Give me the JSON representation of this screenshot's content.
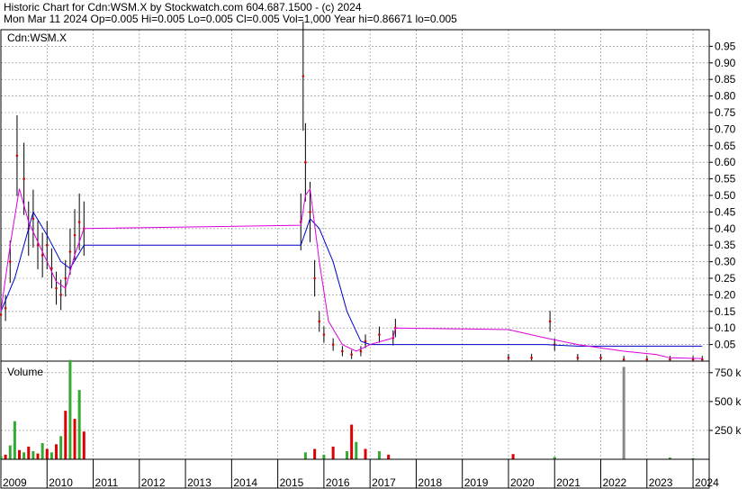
{
  "header": {
    "line1": "Historic Chart for Cdn:WSM.X by Stockwatch.com 604.687.1500 - (c) 2024",
    "line2": "Mon Mar 11 2024   Op=0.005  Hi=0.005  Lo=0.005  Cl=0.005  Vol=1,000  Year hi=0.86671  lo=0.005"
  },
  "chart_data": [
    {
      "type": "line",
      "title": "Cdn:WSM.X",
      "x_labels": [
        "2009",
        "2010",
        "2011",
        "2012",
        "2013",
        "2014",
        "2015",
        "2016",
        "2017",
        "2018",
        "2019",
        "2020",
        "2021",
        "2022",
        "2023",
        "2024"
      ],
      "y_ticks": [
        0.05,
        0.1,
        0.15,
        0.2,
        0.25,
        0.3,
        0.35,
        0.4,
        0.45,
        0.5,
        0.55,
        0.6,
        0.65,
        0.7,
        0.75,
        0.8,
        0.85,
        0.9,
        0.95
      ],
      "ylim": [
        0,
        1.0
      ],
      "grid": true,
      "colors": {
        "price": "#000000",
        "close_dot": "#cc0000",
        "ma_short": "#dd00dd",
        "ma_long": "#0000cc"
      },
      "price_points": [
        [
          2009.0,
          0.14
        ],
        [
          2009.1,
          0.16
        ],
        [
          2009.2,
          0.3
        ],
        [
          2009.35,
          0.62
        ],
        [
          2009.5,
          0.55
        ],
        [
          2009.6,
          0.4
        ],
        [
          2009.7,
          0.43
        ],
        [
          2009.8,
          0.35
        ],
        [
          2009.9,
          0.32
        ],
        [
          2010.0,
          0.35
        ],
        [
          2010.1,
          0.28
        ],
        [
          2010.2,
          0.22
        ],
        [
          2010.3,
          0.2
        ],
        [
          2010.4,
          0.25
        ],
        [
          2010.5,
          0.33
        ],
        [
          2010.6,
          0.38
        ],
        [
          2010.7,
          0.42
        ],
        [
          2010.8,
          0.4
        ],
        [
          2015.5,
          0.42
        ],
        [
          2015.55,
          0.86
        ],
        [
          2015.6,
          0.6
        ],
        [
          2015.7,
          0.45
        ],
        [
          2015.8,
          0.25
        ],
        [
          2015.9,
          0.12
        ],
        [
          2016.0,
          0.08
        ],
        [
          2016.2,
          0.05
        ],
        [
          2016.4,
          0.03
        ],
        [
          2016.6,
          0.02
        ],
        [
          2016.8,
          0.03
        ],
        [
          2016.9,
          0.06
        ],
        [
          2017.2,
          0.08
        ],
        [
          2017.5,
          0.07
        ],
        [
          2017.55,
          0.1
        ],
        [
          2020.0,
          0.01
        ],
        [
          2020.5,
          0.01
        ],
        [
          2020.9,
          0.12
        ],
        [
          2021.0,
          0.05
        ],
        [
          2021.5,
          0.01
        ],
        [
          2022.0,
          0.01
        ],
        [
          2022.5,
          0.005
        ],
        [
          2023.0,
          0.005
        ],
        [
          2023.5,
          0.005
        ],
        [
          2024.0,
          0.005
        ],
        [
          2024.2,
          0.005
        ]
      ],
      "ma_short": [
        [
          2009.0,
          0.15
        ],
        [
          2009.2,
          0.35
        ],
        [
          2009.4,
          0.52
        ],
        [
          2009.6,
          0.42
        ],
        [
          2009.8,
          0.36
        ],
        [
          2010.0,
          0.3
        ],
        [
          2010.2,
          0.24
        ],
        [
          2010.4,
          0.22
        ],
        [
          2010.6,
          0.32
        ],
        [
          2010.8,
          0.4
        ],
        [
          2015.5,
          0.41
        ],
        [
          2015.6,
          0.5
        ],
        [
          2015.7,
          0.52
        ],
        [
          2015.9,
          0.3
        ],
        [
          2016.1,
          0.12
        ],
        [
          2016.4,
          0.05
        ],
        [
          2016.7,
          0.03
        ],
        [
          2017.0,
          0.05
        ],
        [
          2017.5,
          0.07
        ],
        [
          2017.55,
          0.1
        ],
        [
          2020.0,
          0.095
        ],
        [
          2020.8,
          0.07
        ],
        [
          2021.5,
          0.05
        ],
        [
          2022.5,
          0.03
        ],
        [
          2023.2,
          0.02
        ],
        [
          2023.5,
          0.01
        ],
        [
          2024.2,
          0.008
        ]
      ],
      "ma_long": [
        [
          2009.0,
          0.15
        ],
        [
          2009.3,
          0.25
        ],
        [
          2009.7,
          0.45
        ],
        [
          2010.0,
          0.38
        ],
        [
          2010.3,
          0.3
        ],
        [
          2010.5,
          0.28
        ],
        [
          2010.8,
          0.35
        ],
        [
          2015.5,
          0.35
        ],
        [
          2015.7,
          0.43
        ],
        [
          2015.9,
          0.4
        ],
        [
          2016.2,
          0.3
        ],
        [
          2016.5,
          0.15
        ],
        [
          2016.8,
          0.06
        ],
        [
          2017.0,
          0.05
        ],
        [
          2017.5,
          0.05
        ],
        [
          2020.8,
          0.05
        ],
        [
          2021.5,
          0.045
        ],
        [
          2022.5,
          0.045
        ],
        [
          2024.2,
          0.045
        ]
      ]
    },
    {
      "type": "bar",
      "title": "Volume",
      "y_ticks": [
        "750 k",
        "500 k",
        "250 k"
      ],
      "ylim": [
        0,
        850000
      ],
      "colors": {
        "volume_up": "#33aa33",
        "volume_down": "#dd0000",
        "volume_flat": "#888888"
      },
      "bars": [
        [
          2009.0,
          30000,
          "up"
        ],
        [
          2009.1,
          40000,
          "down"
        ],
        [
          2009.2,
          120000,
          "up"
        ],
        [
          2009.3,
          330000,
          "up"
        ],
        [
          2009.4,
          80000,
          "down"
        ],
        [
          2009.5,
          60000,
          "up"
        ],
        [
          2009.6,
          110000,
          "down"
        ],
        [
          2009.7,
          70000,
          "up"
        ],
        [
          2009.8,
          50000,
          "down"
        ],
        [
          2009.9,
          140000,
          "up"
        ],
        [
          2010.0,
          90000,
          "down"
        ],
        [
          2010.1,
          60000,
          "up"
        ],
        [
          2010.2,
          130000,
          "down"
        ],
        [
          2010.3,
          200000,
          "up"
        ],
        [
          2010.4,
          420000,
          "down"
        ],
        [
          2010.5,
          860000,
          "up"
        ],
        [
          2010.6,
          350000,
          "down"
        ],
        [
          2010.7,
          600000,
          "up"
        ],
        [
          2010.8,
          240000,
          "down"
        ],
        [
          2015.6,
          60000,
          "up"
        ],
        [
          2015.8,
          90000,
          "down"
        ],
        [
          2016.0,
          40000,
          "up"
        ],
        [
          2016.2,
          110000,
          "down"
        ],
        [
          2016.5,
          70000,
          "up"
        ],
        [
          2016.6,
          300000,
          "down"
        ],
        [
          2016.7,
          150000,
          "up"
        ],
        [
          2016.9,
          90000,
          "down"
        ],
        [
          2017.2,
          70000,
          "up"
        ],
        [
          2017.4,
          40000,
          "down"
        ],
        [
          2020.1,
          45000,
          "down"
        ],
        [
          2021.0,
          20000,
          "up"
        ],
        [
          2022.5,
          800000,
          "flat"
        ],
        [
          2023.5,
          15000,
          "up"
        ],
        [
          2024.0,
          10000,
          "up"
        ]
      ]
    }
  ]
}
